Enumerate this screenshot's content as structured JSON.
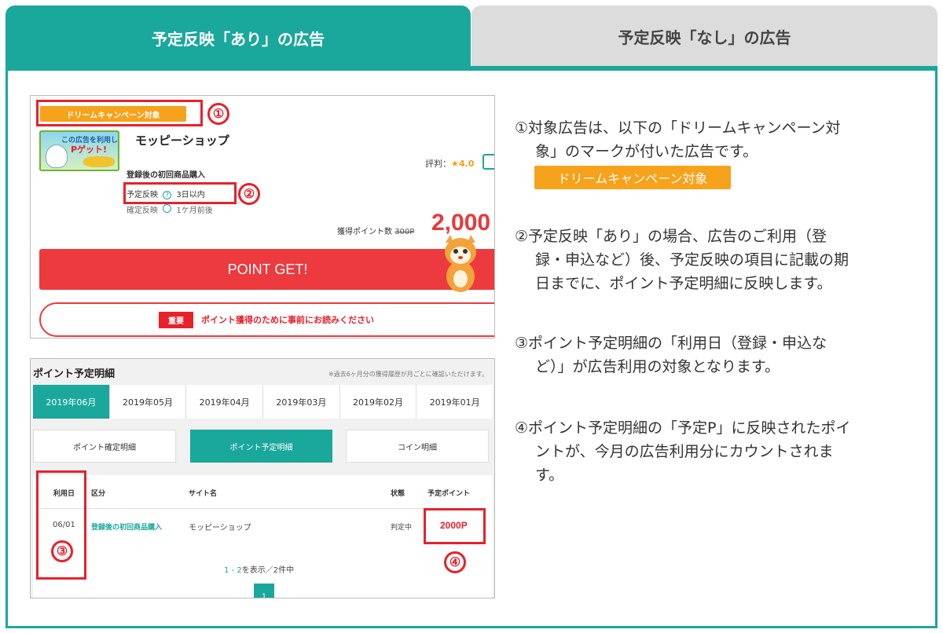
{
  "tabs": {
    "active": "予定反映「あり」の広告",
    "inactive": "予定反映「なし」の広告"
  },
  "shot1": {
    "badge": "ドリームキャンペーン対象",
    "marker1": "①",
    "marker2": "②",
    "logo_line1": "この広告を利用して",
    "logo_line2": "Pゲット!",
    "shop_name": "モッピーショップ",
    "condition": "登録後の初回商品購入",
    "plan_label": "予定反映",
    "plan_value": "3日以内",
    "confirm_label": "確定反映",
    "confirm_value": "1ケ月前後",
    "rating_label": "評判：",
    "rating_value": "★4.0",
    "points_label": "獲得ポイント数",
    "points_old": "300P",
    "points_new": "2,000",
    "button": "POINT GET!",
    "notice_tag": "重要",
    "notice_text": "ポイント獲得のために事前にお読みください"
  },
  "shot2": {
    "title": "ポイント予定明細",
    "note": "※過去6ヶ月分の獲得履歴が月ごとに確認いただけます。",
    "months": [
      "2019年06月",
      "2019年05月",
      "2019年04月",
      "2019年03月",
      "2019年02月",
      "2019年01月"
    ],
    "buttons": [
      "ポイント確定明細",
      "ポイント予定明細",
      "コイン明細"
    ],
    "headers": {
      "date": "利用日",
      "category": "区分",
      "site": "サイト名",
      "status": "状態",
      "points": "予定ポイント"
    },
    "row": {
      "date": "06/01",
      "category": "登録後の初回商品購入",
      "site": "モッピーショップ",
      "status": "判定中",
      "points": "2000P"
    },
    "pager_range": "1 - 2",
    "pager_text": "を表示／2件中",
    "page": "1",
    "marker3": "③",
    "marker4": "④"
  },
  "explain": {
    "p1_l1": "①対象広告は、以下の「ドリームキャンペーン対",
    "p1_l2": "象」のマークが付いた広告です。",
    "badge": "ドリームキャンペーン対象",
    "p2_l1": "②予定反映「あり」の場合、広告のご利用（登",
    "p2_l2": "録・申込など）後、予定反映の項目に記載の期",
    "p2_l3": "日までに、ポイント予定明細に反映します。",
    "p3_l1": "③ポイント予定明細の「利用日（登録・申込な",
    "p3_l2": "ど）」が広告利用の対象となります。",
    "p4_l1": "④ポイント予定明細の「予定P」に反映されたポイ",
    "p4_l2": "ントが、今月の広告利用分にカウントされま",
    "p4_l3": "す。"
  }
}
